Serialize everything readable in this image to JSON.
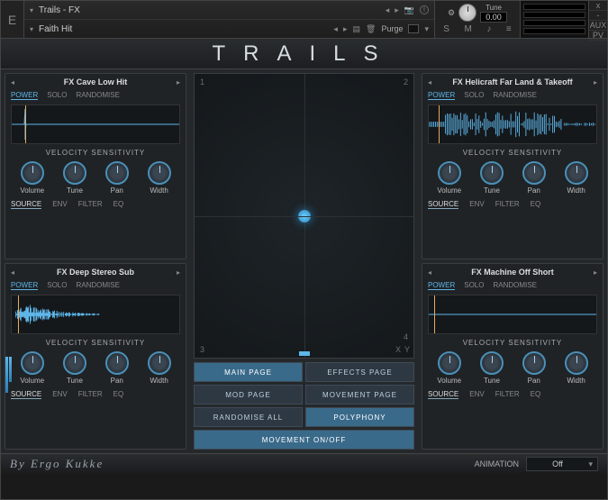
{
  "topbar": {
    "logo": "E",
    "bank": "Trails - FX",
    "preset": "Faith Hit",
    "purge_label": "Purge",
    "tune_label": "Tune",
    "tune_value": "0.00",
    "close": "x",
    "min": "-",
    "aux": "AUX",
    "s": "S",
    "m": "M"
  },
  "title": "TRAILS",
  "slots": [
    {
      "name": "FX Cave Low Hit",
      "tabs": [
        "POWER",
        "SOLO",
        "RANDOMISE"
      ],
      "active_tab": 0,
      "wave_style": "spike",
      "cursor_pct": 8,
      "vel_label": "VELOCITY SENSITIVITY",
      "knobs": [
        "Volume",
        "Tune",
        "Pan",
        "Width"
      ],
      "btm": [
        "SOURCE",
        "ENV",
        "FILTER",
        "EQ"
      ],
      "btm_active": 0
    },
    {
      "name": "FX Helicraft Far Land & Takeoff",
      "tabs": [
        "POWER",
        "SOLO",
        "RANDOMISE"
      ],
      "active_tab": 0,
      "wave_style": "dense",
      "cursor_pct": 6,
      "vel_label": "VELOCITY SENSITIVITY",
      "knobs": [
        "Volume",
        "Tune",
        "Pan",
        "Width"
      ],
      "btm": [
        "SOURCE",
        "ENV",
        "FILTER",
        "EQ"
      ],
      "btm_active": 0
    },
    {
      "name": "FX Deep Stereo Sub",
      "tabs": [
        "POWER",
        "SOLO",
        "RANDOMISE"
      ],
      "active_tab": 0,
      "wave_style": "burst",
      "cursor_pct": 4,
      "vel_label": "VELOCITY SENSITIVITY",
      "knobs": [
        "Volume",
        "Tune",
        "Pan",
        "Width"
      ],
      "btm": [
        "SOURCE",
        "ENV",
        "FILTER",
        "EQ"
      ],
      "btm_active": 0,
      "meter": [
        60,
        40
      ]
    },
    {
      "name": "FX Machine Off Short",
      "tabs": [
        "POWER",
        "SOLO",
        "RANDOMISE"
      ],
      "active_tab": 0,
      "wave_style": "flat",
      "cursor_pct": 3,
      "vel_label": "VELOCITY SENSITIVITY",
      "knobs": [
        "Volume",
        "Tune",
        "Pan",
        "Width"
      ],
      "btm": [
        "SOURCE",
        "ENV",
        "FILTER",
        "EQ"
      ],
      "btm_active": 0
    }
  ],
  "xy": {
    "corners": [
      "1",
      "2",
      "3",
      "4"
    ],
    "x_label": "X",
    "y_label": "Y"
  },
  "nav": [
    {
      "label": "MAIN PAGE",
      "hl": true
    },
    {
      "label": "EFFECTS PAGE",
      "hl": false
    },
    {
      "label": "MOD PAGE",
      "hl": false
    },
    {
      "label": "MOVEMENT PAGE",
      "hl": false
    },
    {
      "label": "RANDOMISE ALL",
      "hl": false
    },
    {
      "label": "POLYPHONY",
      "hl": true
    },
    {
      "label": "MOVEMENT ON/OFF",
      "hl": true,
      "wide": true
    }
  ],
  "footer": {
    "credit": "By Ergo Kukke",
    "anim_label": "ANIMATION",
    "anim_value": "Off"
  }
}
